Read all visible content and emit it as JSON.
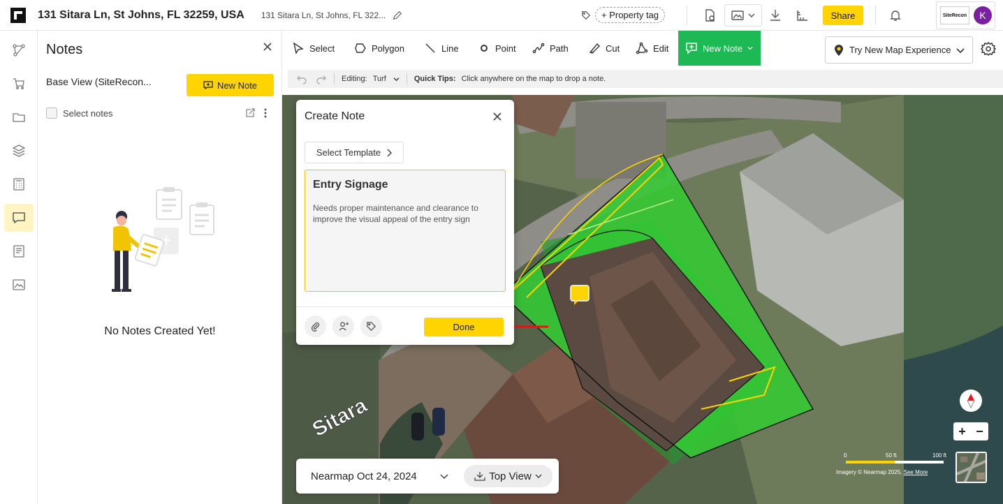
{
  "header": {
    "address_title": "131 Sitara Ln, St Johns, FL 32259, USA",
    "address_short": "131 Sitara Ln, St Johns, FL 322...",
    "property_tag": "+ Property tag",
    "share_label": "Share",
    "org_logo_text": "SiteRecon",
    "avatar_initial": "K"
  },
  "rail": {
    "items": [
      "polygon-tool-icon",
      "cart-icon",
      "folder-icon",
      "layers-icon",
      "calculator-icon",
      "notes-icon",
      "document-icon",
      "image-icon"
    ],
    "active": "notes-icon"
  },
  "notes_panel": {
    "title": "Notes",
    "view_name": "Base View (SiteRecon...",
    "new_note_label": "New Note",
    "select_notes_label": "Select notes",
    "empty_text": "No Notes Created Yet!"
  },
  "toolbar": {
    "tools": [
      {
        "label": "Select",
        "icon": "cursor-icon"
      },
      {
        "label": "Polygon",
        "icon": "polygon-icon"
      },
      {
        "label": "Line",
        "icon": "line-icon"
      },
      {
        "label": "Point",
        "icon": "point-icon"
      },
      {
        "label": "Path",
        "icon": "path-icon"
      },
      {
        "label": "Cut",
        "icon": "cut-icon"
      },
      {
        "label": "Edit",
        "icon": "edit-icon"
      },
      {
        "label": "New Note",
        "icon": "note-add-icon"
      }
    ],
    "map_experience_label": "Try New Map Experience",
    "active_color": "#1db954"
  },
  "subbar": {
    "editing_label": "Editing:",
    "editing_value": "Turf",
    "tips_label": "Quick Tips:",
    "tips_text": "Click anywhere on the map to drop a note."
  },
  "create_note": {
    "title": "Create Note",
    "template_label": "Select Template",
    "note_title": "Entry Signage",
    "note_body": "Needs proper maintenance and clearance to improve the visual appeal of the entry sign",
    "done_label": "Done"
  },
  "map": {
    "street_label": "Sitara",
    "date_label": "Nearmap Oct 24, 2024",
    "view_label": "Top View",
    "scale_ticks": [
      "0",
      "50 ft",
      "100 ft"
    ],
    "credit_text": "Imagery © Nearmap 2025,",
    "credit_link": "See More",
    "zoom_in": "+",
    "zoom_out": "−"
  },
  "colors": {
    "accent_yellow": "#ffd400",
    "turf_green": "#33cc33",
    "brand_purple": "#7b1fa2"
  }
}
